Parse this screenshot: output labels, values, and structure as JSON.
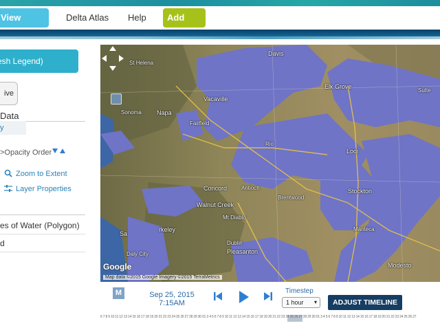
{
  "nav": {
    "view_layers": "View Layers",
    "delta_atlas": "Delta Atlas",
    "help": "Help",
    "add_new": "Add New"
  },
  "sidebar": {
    "legend_button": "resh Legend)",
    "active_button": "ive",
    "section_title": "Data",
    "layer_item": "y",
    "opacity_label": ">Opacity",
    "order_label": "Order",
    "zoom_to_extent": "Zoom to Extent",
    "layer_properties": "Layer Properties",
    "water_layer": "es of Water (Polygon)",
    "second_layer": "d"
  },
  "map": {
    "places": [
      {
        "label": "Davis",
        "big": true
      },
      {
        "label": "St Helena",
        "big": false
      },
      {
        "label": "Vacaville",
        "big": true
      },
      {
        "label": "Elk Grove",
        "big": true
      },
      {
        "label": "Sonoma",
        "big": false
      },
      {
        "label": "Napa",
        "big": true
      },
      {
        "label": "Fairfield",
        "big": false
      },
      {
        "label": "Rio",
        "big": false
      },
      {
        "label": "Lodi",
        "big": true
      },
      {
        "label": "Antioch",
        "big": false
      },
      {
        "label": "Concord",
        "big": true
      },
      {
        "label": "Brentwood",
        "big": false
      },
      {
        "label": "Stockton",
        "big": true
      },
      {
        "label": "Walnut Creek",
        "big": true
      },
      {
        "label": "Mt Diablo",
        "big": false
      },
      {
        "label": "rkeley",
        "big": true
      },
      {
        "label": "Sa",
        "big": true
      },
      {
        "label": "Daly City",
        "big": false
      },
      {
        "label": "Dublin",
        "big": false
      },
      {
        "label": "Pleasanton",
        "big": true
      },
      {
        "label": "Manteca",
        "big": false
      },
      {
        "label": "Modesto",
        "big": true
      },
      {
        "label": "Sutte",
        "big": false
      }
    ],
    "google_logo": "Google",
    "attribution": "Map data ©2015 Google Imagery ©2015 TerraMetrics"
  },
  "timeline": {
    "m_button": "M",
    "date": "Sep 25, 2015",
    "time": "7:15AM",
    "timestep_label": "Timestep",
    "timestep_value": "1 hour",
    "adjust_button": "ADJUST TIMELINE",
    "ruler": "6 7 8 9 10 11 12 13 14 15 16 17 18 19 20 21 22 23 24 25 26 27 28 29 30 01  3 4 5 6 7 8 9 10 11 12 13 14 15 16 17 18 19 20 21 22 23 24 25 26 27 28 29 30 01  3 4 5 6 7 8 9 10 11 12 13 14 15 16 17 18 19 20 21 22 23 24 25 26 27"
  },
  "colors": {
    "water": "#6f74c6",
    "accent": "#2eb0cc",
    "add_new": "#a6c21a",
    "timeline_button": "#163d63"
  }
}
